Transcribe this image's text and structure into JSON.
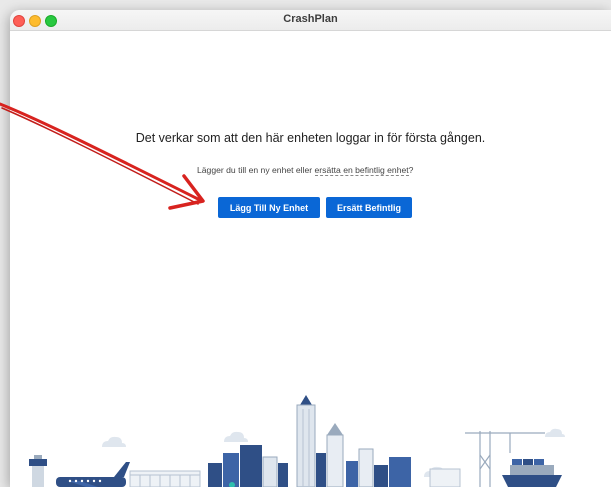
{
  "window": {
    "title": "CrashPlan",
    "traffic_lights": [
      "close",
      "minimize",
      "zoom"
    ]
  },
  "main": {
    "headline": "Det verkar som att den här enheten loggar in för första gången.",
    "subline_prefix": "Lägger du till en ny enhet eller ",
    "subline_link": "ersätta en befintlig enhet",
    "subline_suffix": "?",
    "add_button_label": "Lägg Till Ny Enhet",
    "replace_button_label": "Ersätt Befintlig"
  },
  "colors": {
    "accent": "#0a67d6",
    "annotation": "#d8231f",
    "skyline_dark": "#2f4f86",
    "skyline_light": "#dfe6ee"
  },
  "illustration": {
    "name": "city-skyline-illustration"
  }
}
